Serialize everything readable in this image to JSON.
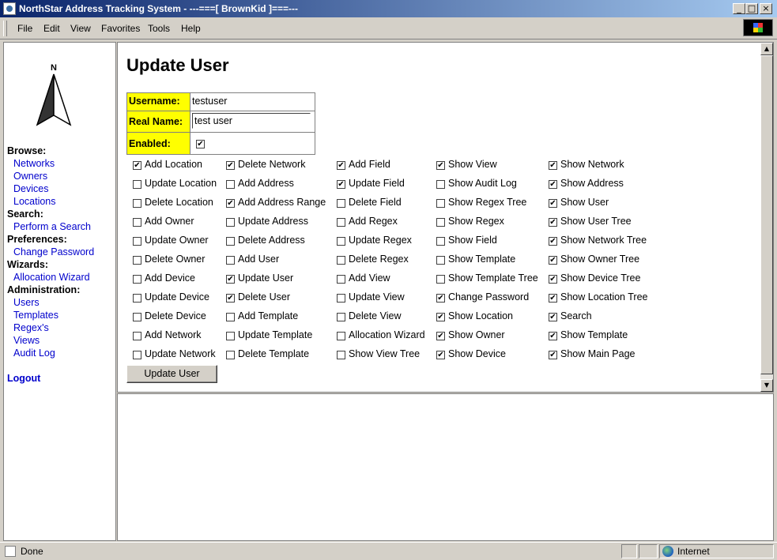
{
  "window": {
    "title": "NorthStar Address Tracking System - ---===[ BrownKid ]===---"
  },
  "menu": [
    "File",
    "Edit",
    "View",
    "Favorites",
    "Tools",
    "Help"
  ],
  "nav": {
    "compass_letter": "N",
    "sections": [
      {
        "heading": "Browse:",
        "links": [
          "Networks",
          "Owners",
          "Devices",
          "Locations"
        ]
      },
      {
        "heading": "Search:",
        "links": [
          "Perform a Search"
        ]
      },
      {
        "heading": "Preferences:",
        "links": [
          "Change Password"
        ]
      },
      {
        "heading": "Wizards:",
        "links": [
          "Allocation Wizard"
        ]
      },
      {
        "heading": "Administration:",
        "links": [
          "Users",
          "Templates",
          "Regex's",
          "Views",
          "Audit Log"
        ]
      }
    ],
    "logout": "Logout"
  },
  "form": {
    "title": "Update User",
    "username_label": "Username:",
    "username_value": "testuser",
    "realname_label": "Real Name:",
    "realname_value": "test user",
    "enabled_label": "Enabled:",
    "enabled_checked": true,
    "submit_label": "Update User"
  },
  "permissions": [
    [
      {
        "label": "Add Location",
        "checked": true
      },
      {
        "label": "Update Location",
        "checked": false
      },
      {
        "label": "Delete Location",
        "checked": false
      },
      {
        "label": "Add Owner",
        "checked": false
      },
      {
        "label": "Update Owner",
        "checked": false
      },
      {
        "label": "Delete Owner",
        "checked": false
      },
      {
        "label": "Add Device",
        "checked": false
      },
      {
        "label": "Update Device",
        "checked": false
      },
      {
        "label": "Delete Device",
        "checked": false
      },
      {
        "label": "Add Network",
        "checked": false
      },
      {
        "label": "Update Network",
        "checked": false
      }
    ],
    [
      {
        "label": "Delete Network",
        "checked": true
      },
      {
        "label": "Add Address",
        "checked": false
      },
      {
        "label": "Add Address Range",
        "checked": true
      },
      {
        "label": "Update Address",
        "checked": false
      },
      {
        "label": "Delete Address",
        "checked": false
      },
      {
        "label": "Add User",
        "checked": false
      },
      {
        "label": "Update User",
        "checked": true
      },
      {
        "label": "Delete User",
        "checked": true
      },
      {
        "label": "Add Template",
        "checked": false
      },
      {
        "label": "Update Template",
        "checked": false
      },
      {
        "label": "Delete Template",
        "checked": false
      }
    ],
    [
      {
        "label": "Add Field",
        "checked": true
      },
      {
        "label": "Update Field",
        "checked": true
      },
      {
        "label": "Delete Field",
        "checked": false
      },
      {
        "label": "Add Regex",
        "checked": false
      },
      {
        "label": "Update Regex",
        "checked": false
      },
      {
        "label": "Delete Regex",
        "checked": false
      },
      {
        "label": "Add View",
        "checked": false
      },
      {
        "label": "Update View",
        "checked": false
      },
      {
        "label": "Delete View",
        "checked": false
      },
      {
        "label": "Allocation Wizard",
        "checked": false
      },
      {
        "label": "Show View Tree",
        "checked": false
      }
    ],
    [
      {
        "label": "Show View",
        "checked": true
      },
      {
        "label": "Show Audit Log",
        "checked": false
      },
      {
        "label": "Show Regex Tree",
        "checked": false
      },
      {
        "label": "Show Regex",
        "checked": false
      },
      {
        "label": "Show Field",
        "checked": false
      },
      {
        "label": "Show Template",
        "checked": false
      },
      {
        "label": "Show Template Tree",
        "checked": false
      },
      {
        "label": "Change Password",
        "checked": true
      },
      {
        "label": "Show Location",
        "checked": true
      },
      {
        "label": "Show Owner",
        "checked": true
      },
      {
        "label": "Show Device",
        "checked": true
      }
    ],
    [
      {
        "label": "Show Network",
        "checked": true
      },
      {
        "label": "Show Address",
        "checked": true
      },
      {
        "label": "Show User",
        "checked": true
      },
      {
        "label": "Show User Tree",
        "checked": true
      },
      {
        "label": "Show Network Tree",
        "checked": true
      },
      {
        "label": "Show Owner Tree",
        "checked": true
      },
      {
        "label": "Show Device Tree",
        "checked": true
      },
      {
        "label": "Show Location Tree",
        "checked": true
      },
      {
        "label": "Search",
        "checked": true
      },
      {
        "label": "Show Template",
        "checked": true
      },
      {
        "label": "Show Main Page",
        "checked": true
      }
    ]
  ],
  "status": {
    "text": "Done",
    "zone": "Internet"
  },
  "colors": {
    "label_bg": "#ffff00",
    "link": "#0000cc",
    "titlebar_start": "#0a246a",
    "titlebar_end": "#a6caf0"
  }
}
